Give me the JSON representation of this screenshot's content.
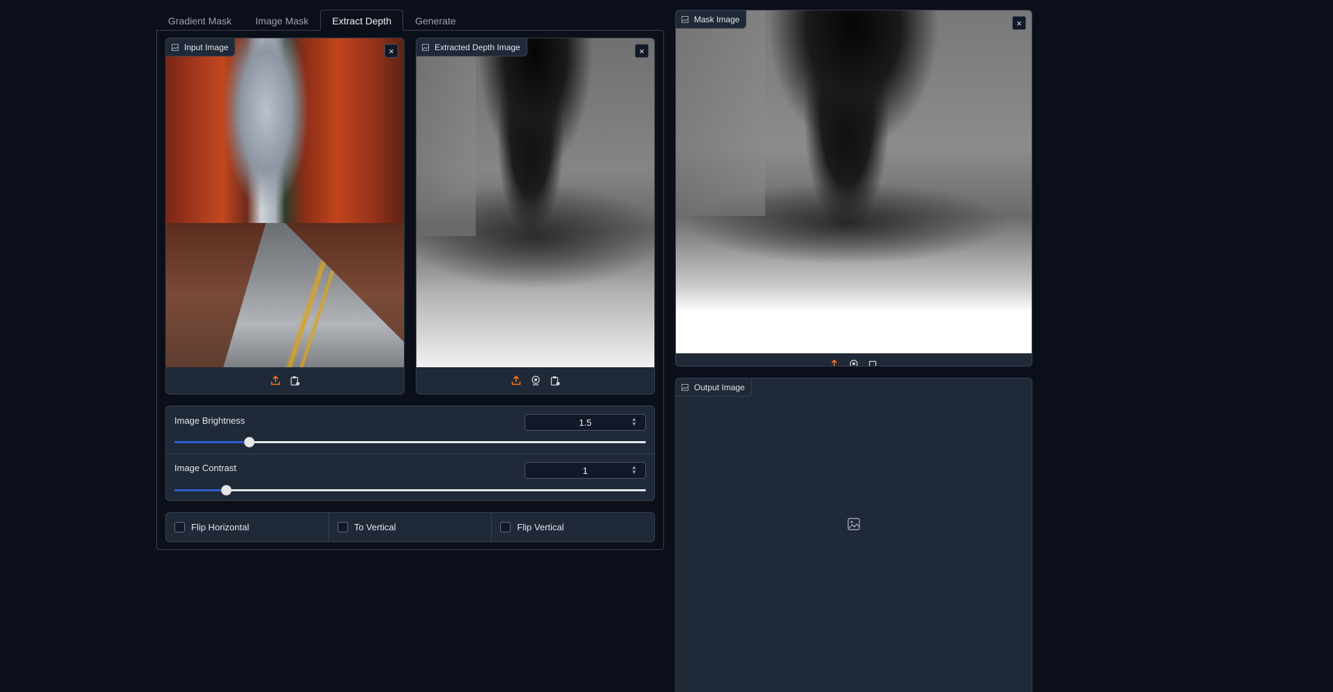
{
  "tabs": [
    "Gradient Mask",
    "Image Mask",
    "Extract Depth",
    "Generate"
  ],
  "active_tab": "Extract Depth",
  "input_image": {
    "label": "Input Image",
    "close": "×"
  },
  "depth_image": {
    "label": "Extracted Depth Image",
    "close": "×"
  },
  "mask_image": {
    "label": "Mask Image",
    "close": "×"
  },
  "output_image": {
    "label": "Output Image"
  },
  "sliders": {
    "brightness": {
      "label": "Image Brightness",
      "value": "1.5",
      "fraction": 0.158
    },
    "contrast": {
      "label": "Image Contrast",
      "value": "1",
      "fraction": 0.109
    }
  },
  "checkboxes": {
    "flip_horizontal": {
      "label": "Flip Horizontal",
      "checked": false
    },
    "to_vertical": {
      "label": "To Vertical",
      "checked": false
    },
    "flip_vertical": {
      "label": "Flip Vertical",
      "checked": false
    }
  },
  "colors": {
    "accent": "#2d5cd3",
    "upload_icon": "#f97316",
    "background": "#0b0f19",
    "panel": "#1f2937"
  },
  "icons": [
    "image-icon",
    "close-icon",
    "upload-icon",
    "webcam-icon",
    "clipboard-icon",
    "spinner-icon"
  ]
}
